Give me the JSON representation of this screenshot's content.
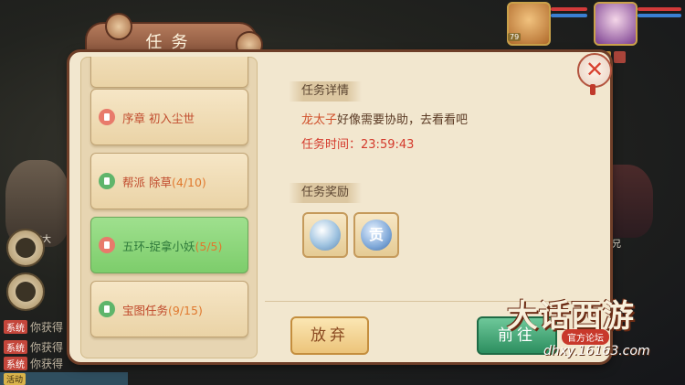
{
  "dialog": {
    "title": "任务",
    "tasks": [
      {
        "name": "序章 初入尘世",
        "progress": "",
        "icon": "scroll-icon",
        "color": "red",
        "active": false
      },
      {
        "name": "帮派 除草",
        "progress": "(4/10)",
        "icon": "person-icon",
        "color": "green",
        "active": false
      },
      {
        "name": "五环-捉拿小妖",
        "progress": "(5/5)",
        "icon": "scroll-icon",
        "color": "red",
        "active": true
      },
      {
        "name": "宝图任务",
        "progress": "(9/15)",
        "icon": "person-icon",
        "color": "green",
        "active": false
      }
    ],
    "detail": {
      "section_title": "任务详情",
      "npc": "龙太子",
      "description": "好像需要协助，去看看吧",
      "time_label": "任务时间：",
      "time_value": "23:59:43"
    },
    "rewards": {
      "section_title": "任务奖励",
      "items": [
        {
          "icon": "silver-ingot-icon"
        },
        {
          "icon": "experience-coin-icon",
          "glyph": "贡"
        }
      ]
    },
    "buttons": {
      "abandon": "放弃",
      "go": "前往"
    }
  },
  "background": {
    "npc_name_left": "的大",
    "npc_name_right": "兄",
    "chat": [
      {
        "tag": "系统",
        "text": "你获得"
      },
      {
        "tag": "系统",
        "text": "你获得"
      },
      {
        "tag": "系统",
        "text": "你获得"
      }
    ],
    "bottom_tag": "活动"
  },
  "portraits": {
    "player_level": "79",
    "pet_level": ""
  },
  "watermark": {
    "title": "大话西游",
    "subtitle": "官方论坛",
    "url": "dhxy.16163.com"
  }
}
